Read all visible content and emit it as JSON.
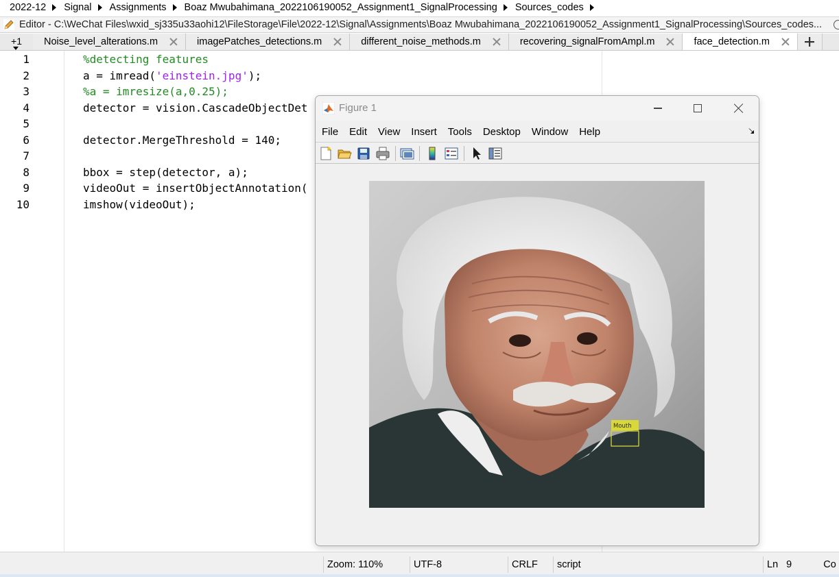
{
  "breadcrumb": [
    "2022-12",
    "Signal",
    "Assignments",
    "Boaz Mwubahimana_2022106190052_Assignment1_SignalProcessing",
    "Sources_codes"
  ],
  "editor_title": "Editor - C:\\WeChat Files\\wxid_sj335u33aohi12\\FileStorage\\File\\2022-12\\Signal\\Assignments\\Boaz Mwubahimana_2022106190052_Assignment1_SignalProcessing\\Sources_codes...",
  "tabs": {
    "count_label": "+1",
    "items": [
      {
        "label": "Noise_level_alterations.m",
        "active": false
      },
      {
        "label": "imagePatches_detections.m",
        "active": false
      },
      {
        "label": "different_noise_methods.m",
        "active": false
      },
      {
        "label": "recovering_signalFromAmpl.m",
        "active": false
      },
      {
        "label": "face_detection.m",
        "active": true
      }
    ]
  },
  "code": {
    "lines": [
      {
        "num": "1",
        "parts": [
          {
            "t": "%detecting features",
            "c": "comment"
          }
        ]
      },
      {
        "num": "2",
        "parts": [
          {
            "t": "a = imread(",
            "c": "normal"
          },
          {
            "t": "'einstein.jpg'",
            "c": "string"
          },
          {
            "t": ");",
            "c": "normal"
          }
        ]
      },
      {
        "num": "3",
        "parts": [
          {
            "t": "%a = imresize(a,0.25);",
            "c": "comment"
          }
        ]
      },
      {
        "num": "4",
        "parts": [
          {
            "t": "detector = vision.CascadeObjectDet",
            "c": "normal"
          }
        ]
      },
      {
        "num": "5",
        "parts": []
      },
      {
        "num": "6",
        "parts": [
          {
            "t": "detector.MergeThreshold = 140;",
            "c": "normal"
          }
        ]
      },
      {
        "num": "7",
        "parts": []
      },
      {
        "num": "8",
        "parts": [
          {
            "t": "bbox = step(detector, a);",
            "c": "normal"
          }
        ]
      },
      {
        "num": "9",
        "parts": [
          {
            "t": "videoOut = insertObjectAnnotation(",
            "c": "normal"
          }
        ]
      },
      {
        "num": "10",
        "parts": [
          {
            "t": "imshow(videoOut);",
            "c": "normal"
          }
        ]
      }
    ]
  },
  "figure": {
    "title": "Figure 1",
    "menu": [
      "File",
      "Edit",
      "View",
      "Insert",
      "Tools",
      "Desktop",
      "Window",
      "Help"
    ],
    "toolbar_icons": [
      "new-figure-icon",
      "open-file-icon",
      "save-icon",
      "print-icon",
      "link-figure-icon",
      "colorbar-icon",
      "legend-icon",
      "pointer-icon",
      "property-inspector-icon"
    ],
    "annotation_label": "Mouth",
    "annotation_color": "#d8d83a"
  },
  "status": {
    "zoom": "Zoom: 110%",
    "encoding": "UTF-8",
    "line_ending": "CRLF",
    "type": "script",
    "ln_label": "Ln",
    "ln_value": "9",
    "col_label": "Co"
  },
  "colors": {
    "comment": "#228b22",
    "string": "#a020f0"
  }
}
